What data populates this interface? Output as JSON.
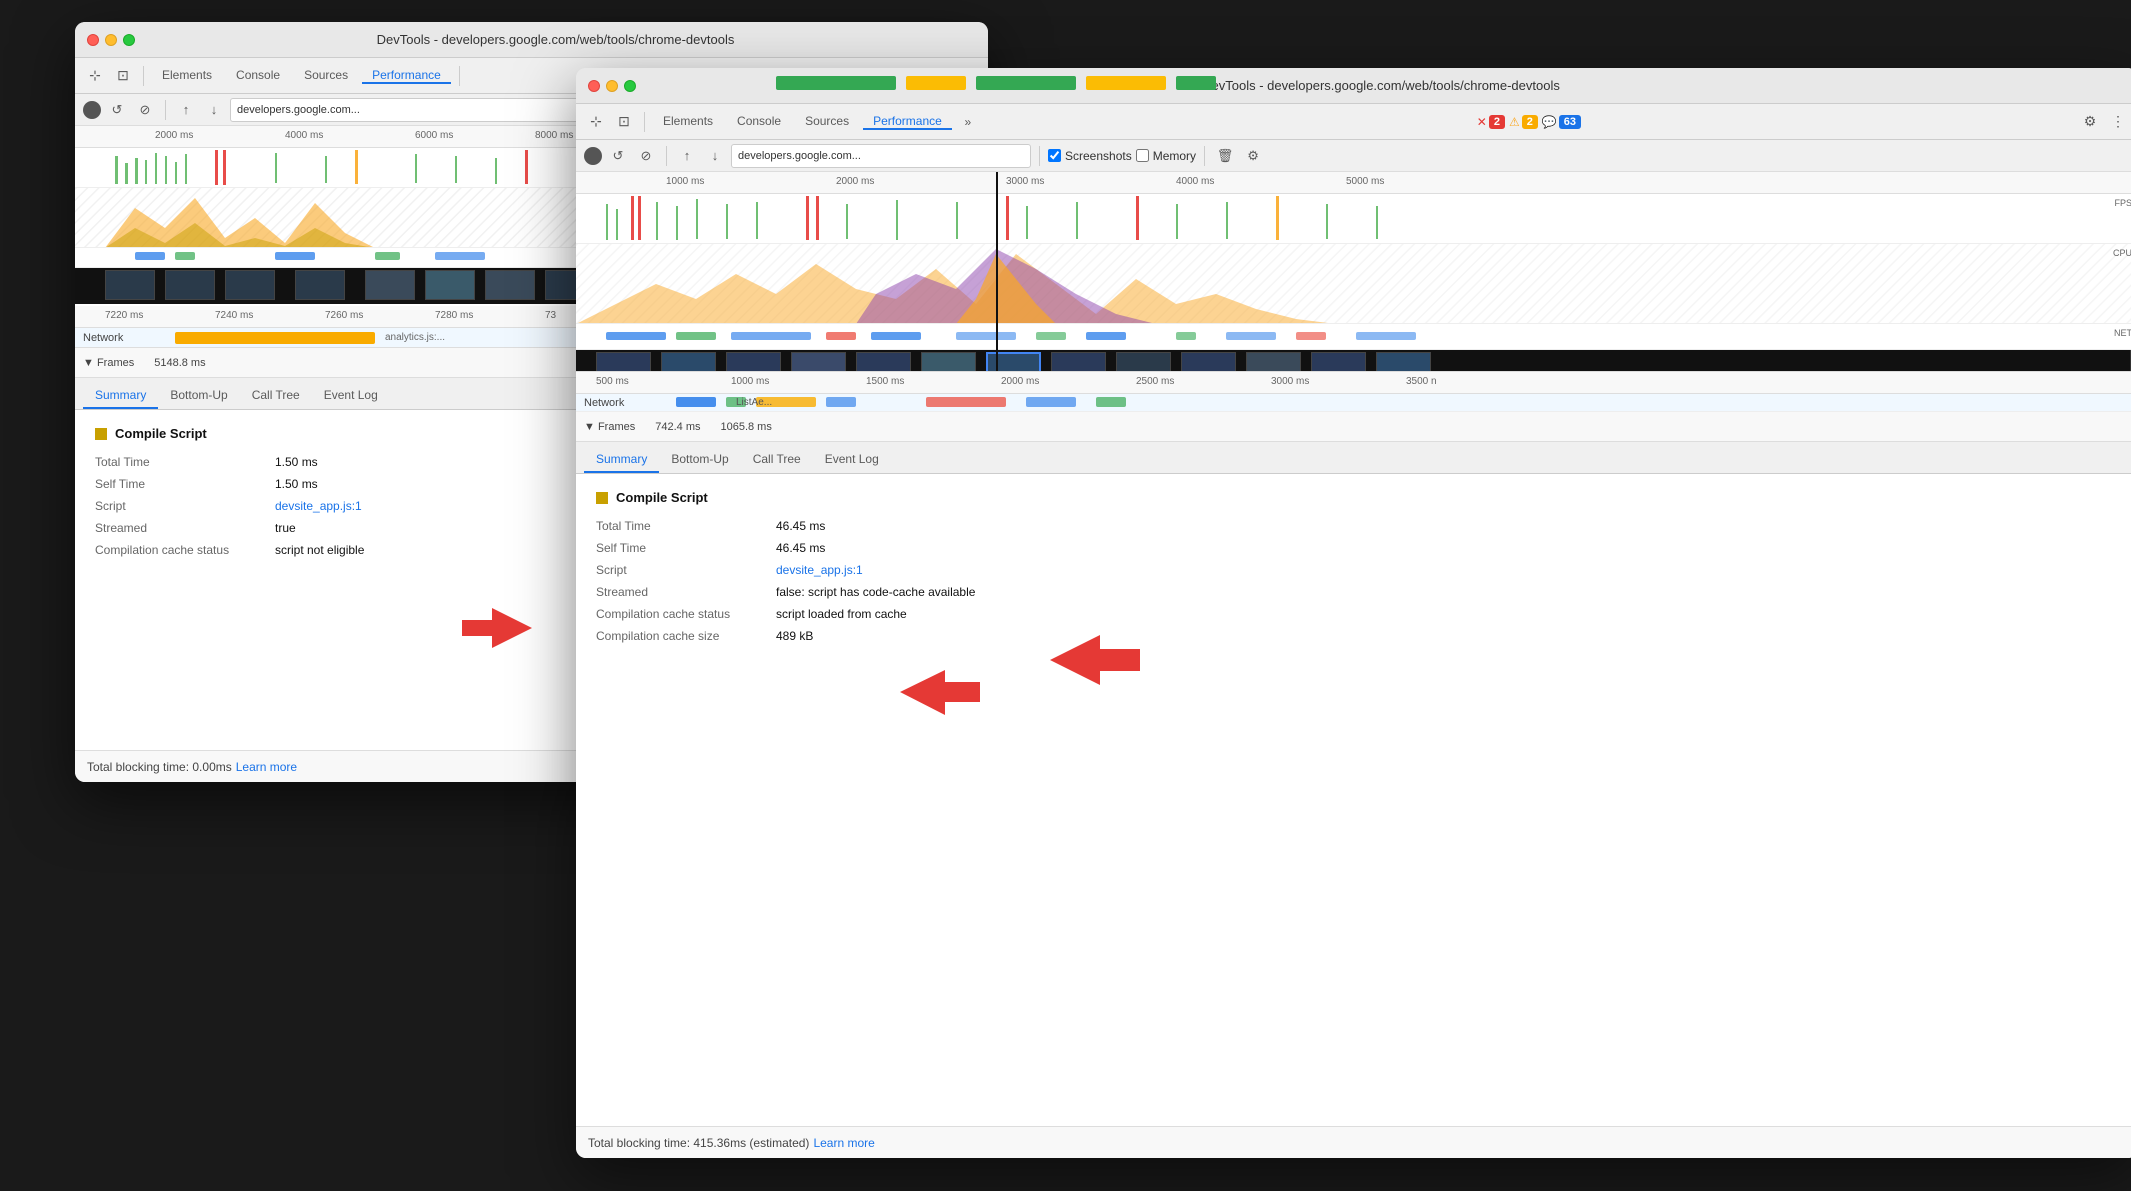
{
  "back_window": {
    "titlebar_title": "DevTools - developers.google.com/web/tools/chrome-devtools",
    "nav_tabs": [
      {
        "label": "Elements",
        "active": false
      },
      {
        "label": "Console",
        "active": false
      },
      {
        "label": "Sources",
        "active": false
      },
      {
        "label": "Performance",
        "active": true
      }
    ],
    "toolbar": {
      "url": "developers.google.com..."
    },
    "timeline_labels": [
      "2000 ms",
      "4000 ms",
      "6000 ms",
      "8000 ms"
    ],
    "second_ruler": [
      "7220 ms",
      "7240 ms",
      "7260 ms",
      "7280 ms",
      "73"
    ],
    "network_label": "Network",
    "frames_label": "▼ Frames",
    "frames_value": "5148.8 ms",
    "panel_tabs": [
      {
        "label": "Summary",
        "active": true
      },
      {
        "label": "Bottom-Up",
        "active": false
      },
      {
        "label": "Call Tree",
        "active": false
      },
      {
        "label": "Event Log",
        "active": false
      }
    ],
    "summary": {
      "title": "Compile Script",
      "total_time_label": "Total Time",
      "total_time_value": "1.50 ms",
      "self_time_label": "Self Time",
      "self_time_value": "1.50 ms",
      "script_label": "Script",
      "script_link": "devsite_app.js:1",
      "streamed_label": "Streamed",
      "streamed_value": "true",
      "cache_label": "Compilation cache status",
      "cache_value": "script not eligible"
    },
    "bottom_bar": {
      "text": "Total blocking time: 0.00ms",
      "link_text": "Learn more"
    }
  },
  "front_window": {
    "titlebar_title": "DevTools - developers.google.com/web/tools/chrome-devtools",
    "nav_tabs": [
      {
        "label": "Elements",
        "active": false
      },
      {
        "label": "Console",
        "active": false
      },
      {
        "label": "Sources",
        "active": false
      },
      {
        "label": "Performance",
        "active": true
      }
    ],
    "badges": {
      "errors": "2",
      "warnings": "2",
      "messages": "63"
    },
    "toolbar": {
      "url": "developers.google.com...",
      "screenshots_label": "Screenshots",
      "screenshots_checked": true,
      "memory_label": "Memory",
      "memory_checked": false
    },
    "timeline_ruler": [
      "1000 ms",
      "2000 ms",
      "3000 ms",
      "4000 ms",
      "5000 ms"
    ],
    "fps_label": "FPS",
    "cpu_label": "CPU",
    "net_label": "NET",
    "second_ruler": [
      "500 ms",
      "1000 ms",
      "1500 ms",
      "2000 ms",
      "2500 ms",
      "3000 ms",
      "3500 n"
    ],
    "network_label": "Network",
    "frames_label": "▼ Frames",
    "frames_value1": "742.4 ms",
    "frames_value2": "1065.8 ms",
    "panel_tabs": [
      {
        "label": "Summary",
        "active": true
      },
      {
        "label": "Bottom-Up",
        "active": false
      },
      {
        "label": "Call Tree",
        "active": false
      },
      {
        "label": "Event Log",
        "active": false
      }
    ],
    "summary": {
      "title": "Compile Script",
      "total_time_label": "Total Time",
      "total_time_value": "46.45 ms",
      "self_time_label": "Self Time",
      "self_time_value": "46.45 ms",
      "script_label": "Script",
      "script_link": "devsite_app.js:1",
      "streamed_label": "Streamed",
      "streamed_value": "false: script has code-cache available",
      "cache_label": "Compilation cache status",
      "cache_value": "script loaded from cache",
      "cache_size_label": "Compilation cache size",
      "cache_size_value": "489 kB"
    },
    "bottom_bar": {
      "text": "Total blocking time: 415.36ms (estimated)",
      "link_text": "Learn more"
    }
  },
  "icons": {
    "cursor": "⊹",
    "layers": "⊡",
    "record": "●",
    "reload": "↺",
    "stop": "⊘",
    "upload": "↑",
    "download": "↓",
    "trash": "🗑",
    "gear": "⚙",
    "more": "⋮",
    "chevron_more": "»",
    "triangle_right": "▶",
    "triangle_down": "▼"
  },
  "colors": {
    "active_tab": "#1a73e8",
    "compile_script": "#c8a000",
    "fps_green": "#4caf50",
    "fps_red": "#e53935",
    "cpu_yellow": "#f9a825",
    "cpu_purple": "#8e44ad",
    "cpu_blue": "#1a73e8",
    "link": "#1a73e8",
    "red_arrow": "#e53935"
  }
}
